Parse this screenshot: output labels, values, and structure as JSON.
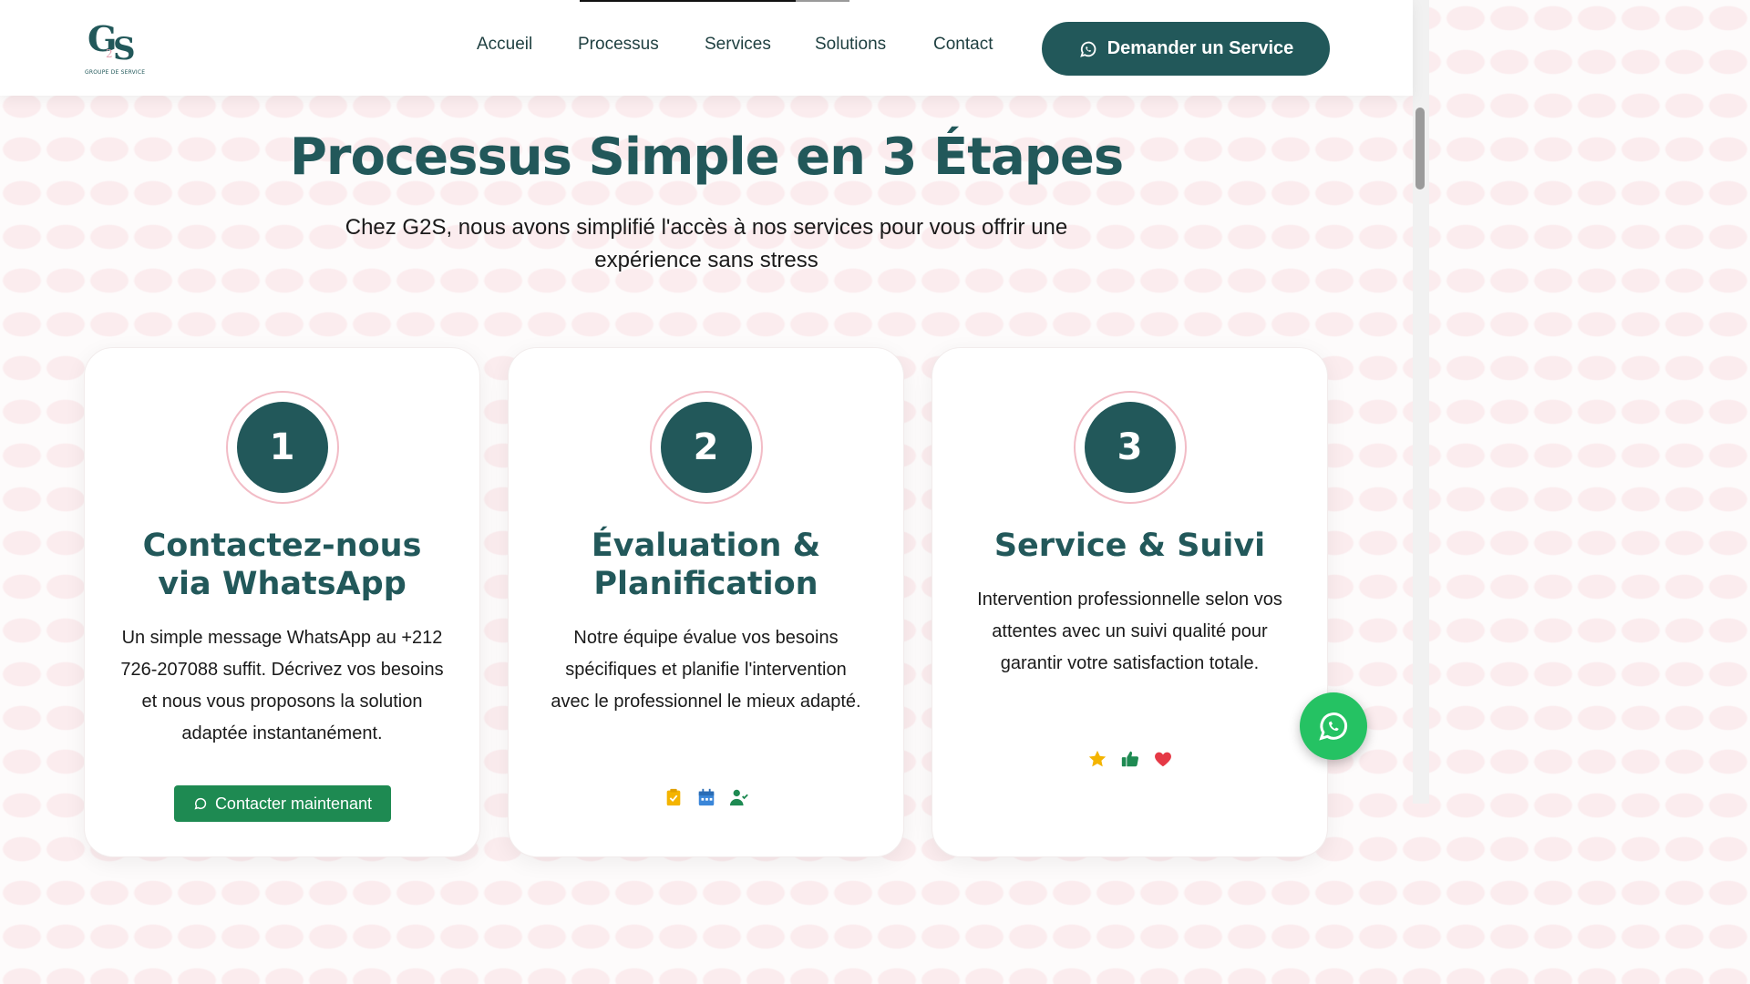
{
  "header": {
    "logo": {
      "mark_g": "G",
      "mark_2": "2",
      "mark_s": "S",
      "tagline": "GROUPE DE SERVICE"
    },
    "scroll_progress": 0.8,
    "nav": [
      {
        "label": "Accueil"
      },
      {
        "label": "Processus"
      },
      {
        "label": "Services"
      },
      {
        "label": "Solutions"
      },
      {
        "label": "Contact"
      }
    ],
    "cta_label": "Demander un Service",
    "cta_icon": "whatsapp-icon"
  },
  "section": {
    "title": "Processus Simple en 3 Étapes",
    "subtitle": "Chez G2S, nous avons simplifié l'accès à nos services pour vous offrir une expérience sans stress"
  },
  "steps": [
    {
      "number": "1",
      "title": "Contactez-nous via WhatsApp",
      "text": "Un simple message WhatsApp au +212 726-207088 suffit. Décrivez vos besoins et nous vous proposons la solution adaptée instantanément.",
      "button_label": "Contacter maintenant"
    },
    {
      "number": "2",
      "title": "Évaluation & Planification",
      "text": "Notre équipe évalue vos besoins spécifiques et planifie l'intervention avec le professionnel le mieux adapté.",
      "icons": [
        "clipboard-check-icon",
        "calendar-icon",
        "user-check-icon"
      ]
    },
    {
      "number": "3",
      "title": "Service & Suivi",
      "text": "Intervention professionnelle selon vos attentes avec un suivi qualité pour garantir votre satisfaction totale.",
      "icons": [
        "star-icon",
        "thumbs-up-icon",
        "heart-icon"
      ]
    }
  ],
  "floating_button_icon": "whatsapp-icon",
  "colors": {
    "primary": "#22585a",
    "accent_pink": "#f2bcc6",
    "whatsapp_green": "#25c263",
    "button_green": "#1e8a52",
    "star": "#f4b400",
    "heart": "#e53946"
  }
}
